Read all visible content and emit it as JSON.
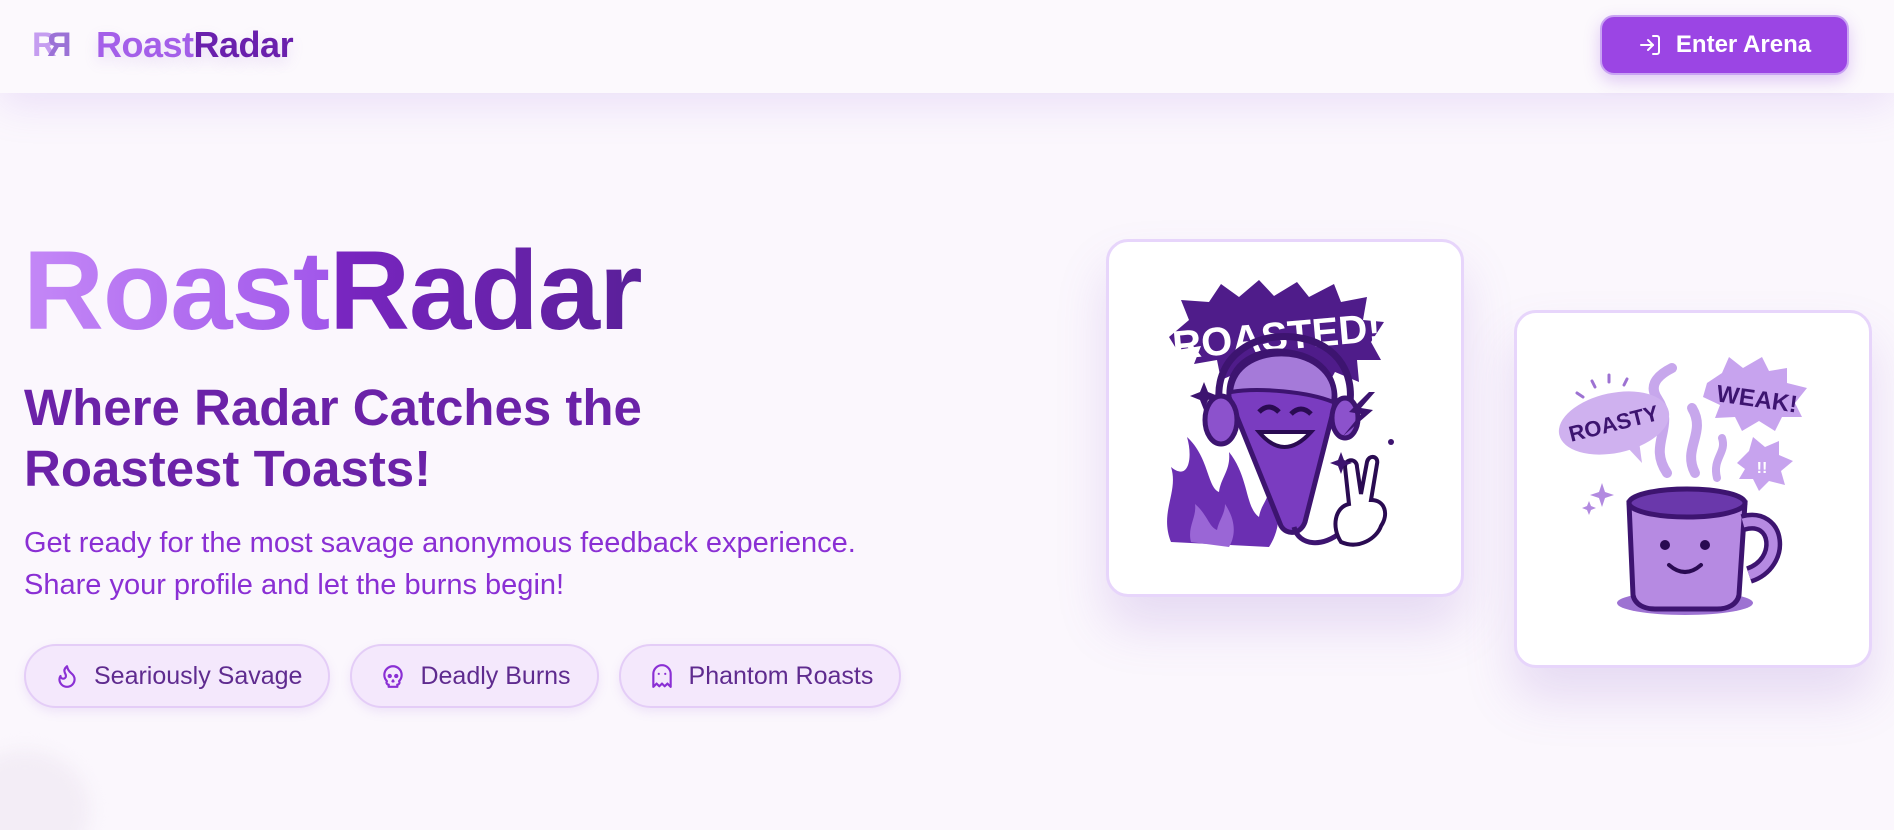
{
  "header": {
    "logo_text": "RR",
    "brand_part1": "Roast",
    "brand_part2": "Radar",
    "enter_button": "Enter Arena"
  },
  "hero": {
    "title_part1": "Roast",
    "title_part2": "Radar",
    "tagline": "Where Radar Catches the Roastest Toasts!",
    "subtext_line1": "Get ready for the most savage anonymous feedback experience.",
    "subtext_line2": "Share your profile and let the burns begin!"
  },
  "features": [
    {
      "label": "Seariously Savage",
      "icon": "flame-icon"
    },
    {
      "label": "Deadly Burns",
      "icon": "skull-icon"
    },
    {
      "label": "Phantom Roasts",
      "icon": "ghost-icon"
    }
  ],
  "illustrations": {
    "card1": {
      "badge_text": "ROASTED!",
      "icon": "microphone-mascot-icon"
    },
    "card2": {
      "bubble1": "ROASTY",
      "bubble2": "WEAK!",
      "bubble3": "!!",
      "icon": "coffee-mug-icon"
    }
  },
  "colors": {
    "accent": "#9b45e4",
    "brand_light": "#a45fe9",
    "brand_dark": "#6a20ad",
    "background": "#fbf7fd"
  }
}
